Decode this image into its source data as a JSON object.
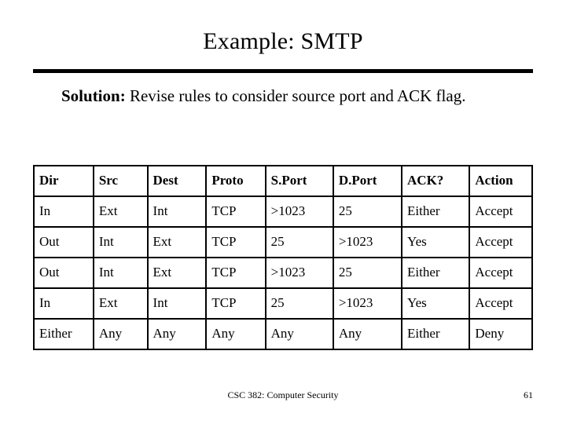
{
  "slide": {
    "title": "Example: SMTP",
    "solution_label": "Solution:",
    "solution_text": " Revise rules to consider source port and ACK flag.",
    "footer": "CSC 382: Computer Security",
    "page_number": "61"
  },
  "table": {
    "headers": [
      "Dir",
      "Src",
      "Dest",
      "Proto",
      "S.Port",
      "D.Port",
      "ACK?",
      "Action"
    ],
    "rows": [
      [
        "In",
        "Ext",
        "Int",
        "TCP",
        ">1023",
        "25",
        "Either",
        "Accept"
      ],
      [
        "Out",
        "Int",
        "Ext",
        "TCP",
        "25",
        ">1023",
        "Yes",
        "Accept"
      ],
      [
        "Out",
        "Int",
        "Ext",
        "TCP",
        ">1023",
        "25",
        "Either",
        "Accept"
      ],
      [
        "In",
        "Ext",
        "Int",
        "TCP",
        "25",
        ">1023",
        "Yes",
        "Accept"
      ],
      [
        "Either",
        "Any",
        "Any",
        "Any",
        "Any",
        "Any",
        "Either",
        "Deny"
      ]
    ]
  }
}
